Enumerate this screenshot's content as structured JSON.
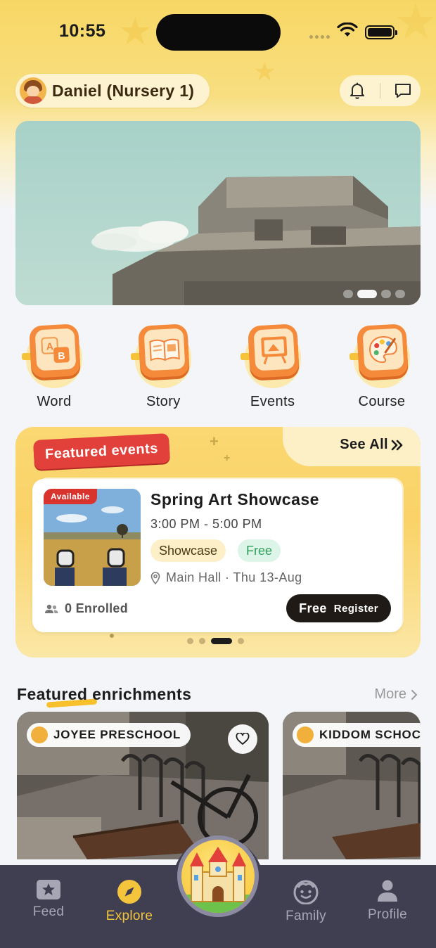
{
  "status_bar": {
    "time": "10:55"
  },
  "header": {
    "profile_name": "Daniel (Nursery 1)"
  },
  "banner": {
    "slide_count": 4,
    "active_slide": 2
  },
  "quick_nav": [
    {
      "label": "Word",
      "icon": "ab-blocks-icon"
    },
    {
      "label": "Story",
      "icon": "open-book-icon"
    },
    {
      "label": "Events",
      "icon": "easel-icon"
    },
    {
      "label": "Course",
      "icon": "palette-icon"
    }
  ],
  "featured_events": {
    "badge": "Featured events",
    "see_all": "See All",
    "event": {
      "availability": "Available",
      "title": "Spring Art Showcase",
      "time": "3:00 PM - 5:00 PM",
      "tags": [
        "Showcase",
        "Free"
      ],
      "location": "Main Hall · Thu 13-Aug",
      "enrolled": "0 Enrolled",
      "price": "Free",
      "register": "Register"
    },
    "pager": {
      "count": 4,
      "active": 3
    }
  },
  "enrichments": {
    "title": "Featured enrichments",
    "more": "More",
    "cards": [
      {
        "school": "JOYEE PRESCHOOL"
      },
      {
        "school": "KIDDOM SCHOC"
      }
    ]
  },
  "tab_bar": {
    "items": [
      {
        "label": "Feed",
        "icon": "star-card-icon"
      },
      {
        "label": "Explore",
        "icon": "compass-icon",
        "active": true
      },
      {
        "label": "Family",
        "icon": "smiley-face-icon"
      },
      {
        "label": "Profile",
        "icon": "person-icon"
      }
    ],
    "center_icon": "castle-icon"
  },
  "colors": {
    "accent_yellow": "#f3c43c",
    "badge_red": "#e2413b",
    "tab_bar_bg": "#403f52",
    "free_green": "#2f9e5c"
  }
}
